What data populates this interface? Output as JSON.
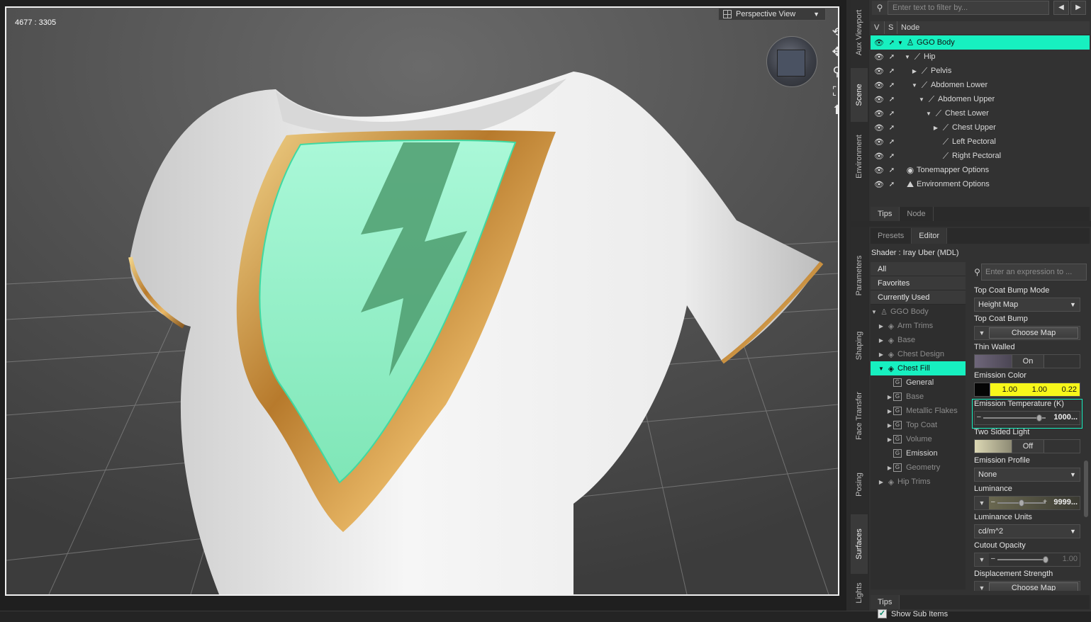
{
  "viewport": {
    "coords": "4677 : 3305",
    "view_menu": "Perspective View",
    "colors": {
      "chest_fill": "#8ff5c9",
      "trim": "#c8923c",
      "shirt": "#f2f2f2",
      "background": "#555555"
    }
  },
  "side_tabs_top": [
    "Aux Viewport",
    "Scene",
    "Environment"
  ],
  "side_tabs_bottom": [
    "Parameters",
    "Shaping",
    "Face Transfer",
    "Posing",
    "Surfaces",
    "Lights"
  ],
  "scene": {
    "filter_placeholder": "Enter text to filter by...",
    "columns": {
      "v": "V",
      "s": "S",
      "node": "Node"
    },
    "nodes": [
      {
        "label": "GGO Body",
        "icon": "figure-icon"
      },
      {
        "label": "Hip",
        "icon": "bone-icon"
      },
      {
        "label": "Pelvis",
        "icon": "bone-icon"
      },
      {
        "label": "Abdomen Lower",
        "icon": "bone-icon"
      },
      {
        "label": "Abdomen Upper",
        "icon": "bone-icon"
      },
      {
        "label": "Chest Lower",
        "icon": "bone-icon"
      },
      {
        "label": "Chest Upper",
        "icon": "bone-icon"
      },
      {
        "label": "Left Pectoral",
        "icon": "bone-icon"
      },
      {
        "label": "Right Pectoral",
        "icon": "bone-icon"
      },
      {
        "label": "Tonemapper Options",
        "icon": "tonemapper-icon"
      },
      {
        "label": "Environment Options",
        "icon": "environment-icon"
      }
    ],
    "tabs": [
      "Tips",
      "Node"
    ]
  },
  "surfaces": {
    "tabs": [
      "Presets",
      "Editor"
    ],
    "shader": "Shader : Iray Uber (MDL)",
    "groups": [
      "All",
      "Favorites",
      "Currently Used"
    ],
    "tree": [
      "GGO Body",
      "Arm Trims",
      "Base",
      "Chest Design",
      "Chest Fill",
      "General",
      "Base",
      "Metallic Flakes",
      "Top Coat",
      "Volume",
      "Emission",
      "Geometry",
      "Hip Trims"
    ],
    "show_sub_items": "Show Sub Items",
    "search_placeholder": "Enter an expression to ...",
    "properties": {
      "top_coat_bump_mode": {
        "label": "Top Coat Bump Mode",
        "value": "Height Map"
      },
      "top_coat_bump": {
        "label": "Top Coat Bump",
        "button": "Choose Map"
      },
      "thin_walled": {
        "label": "Thin Walled",
        "value": "On"
      },
      "emission_color": {
        "label": "Emission Color",
        "r": "1.00",
        "g": "1.00",
        "b": "0.22"
      },
      "emission_temperature": {
        "label": "Emission Temperature (K)",
        "value": "1000...",
        "level": 0.9
      },
      "two_sided_light": {
        "label": "Two Sided Light",
        "value": "Off"
      },
      "emission_profile": {
        "label": "Emission Profile",
        "value": "None"
      },
      "luminance": {
        "label": "Luminance",
        "value": "9999...",
        "level": 0.5
      },
      "luminance_units": {
        "label": "Luminance Units",
        "value": "cd/m^2"
      },
      "cutout_opacity": {
        "label": "Cutout Opacity",
        "value": "1.00",
        "level": 1.0
      },
      "displacement_strength": {
        "label": "Displacement Strength",
        "button": "Choose Map"
      }
    },
    "bottom_tabs": [
      "Tips"
    ]
  }
}
